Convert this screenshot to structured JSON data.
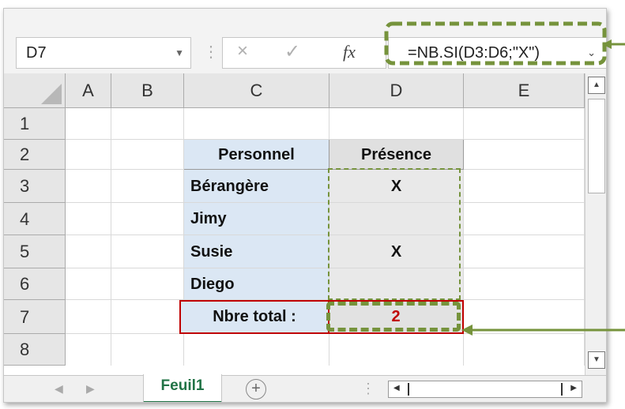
{
  "name_box": "D7",
  "formula_bar": {
    "cancel_icon": "×",
    "enter_icon": "✓",
    "function_label": "fx",
    "formula": "=NB.SI(D3:D6;\"X\")"
  },
  "columns": [
    "A",
    "B",
    "C",
    "D",
    "E"
  ],
  "rows": [
    "1",
    "2",
    "3",
    "4",
    "5",
    "6",
    "7",
    "8"
  ],
  "table": {
    "header_personnel": "Personnel",
    "header_presence": "Présence",
    "entries": [
      {
        "name": "Bérangère",
        "presence": "X"
      },
      {
        "name": "Jimy",
        "presence": ""
      },
      {
        "name": "Susie",
        "presence": "X"
      },
      {
        "name": "Diego",
        "presence": ""
      }
    ],
    "total_label": "Nbre total :",
    "total_value": "2"
  },
  "sheet_tab": "Feuil1",
  "colors": {
    "annotation_green": "#76933c",
    "highlight_red": "#c00000",
    "excel_green": "#217346",
    "table_blue": "#dbe7f4"
  }
}
